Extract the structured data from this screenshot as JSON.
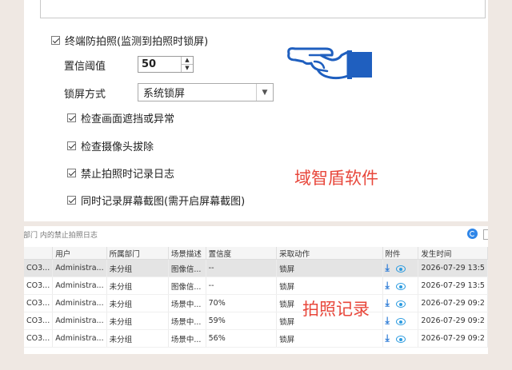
{
  "settings": {
    "terminal_anti_photo": "终端防拍照(监测到拍照时锁屏)",
    "confidence_label": "置信阈值",
    "confidence_value": "50",
    "lock_mode_label": "锁屏方式",
    "lock_mode_value": "系统锁屏",
    "check_occlusion": "检查画面遮挡或异常",
    "check_camera_removed": "检查摄像头拔除",
    "disable_photo_log": "禁止拍照时记录日志",
    "record_screenshot": "同时记录屏幕截图(需开启屏幕截图)"
  },
  "annotations": {
    "brand": "域智盾软件",
    "records": "拍照记录"
  },
  "toolbar": {
    "filter_text": "部门 内的禁止拍照日志"
  },
  "table": {
    "headers": [
      "",
      "用户",
      "所属部门",
      "场景描述",
      "置信度",
      "采取动作",
      "附件",
      "发生时间"
    ],
    "rows": [
      [
        "CO3...",
        "Administra...",
        "未分组",
        "图像信...",
        "--",
        "锁屏",
        "2026-07-29 13:5"
      ],
      [
        "CO3...",
        "Administra...",
        "未分组",
        "图像信...",
        "--",
        "锁屏",
        "2026-07-29 13:5"
      ],
      [
        "CO3...",
        "Administra...",
        "未分组",
        "场景中...",
        "70%",
        "锁屏",
        "2026-07-29 09:2"
      ],
      [
        "CO3...",
        "Administra...",
        "未分组",
        "场景中...",
        "59%",
        "锁屏",
        "2026-07-29 09:2"
      ],
      [
        "CO3...",
        "Administra...",
        "未分组",
        "场景中...",
        "56%",
        "锁屏",
        "2026-07-29 09:2"
      ]
    ]
  },
  "icons": {
    "download": "download-icon",
    "view": "eye-icon",
    "refresh": "refresh-icon"
  },
  "colors": {
    "accent": "#2b7ad6",
    "annotation_red": "#e8473b",
    "hand_blue": "#1f5fbf"
  }
}
